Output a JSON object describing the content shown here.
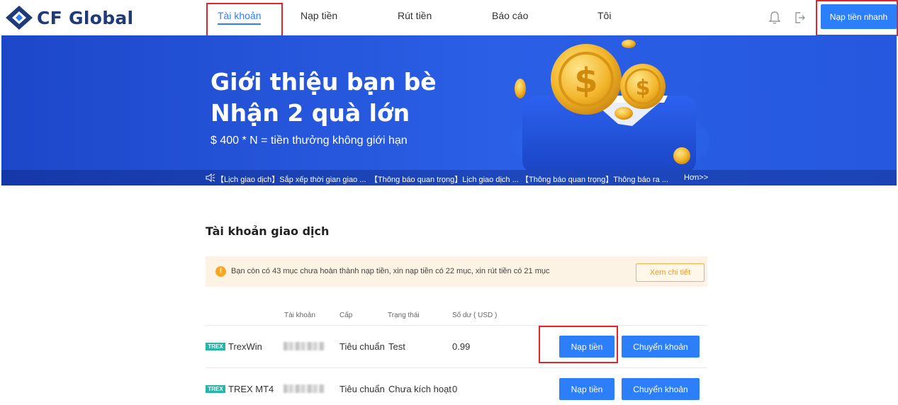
{
  "brand": {
    "name": "CF Global"
  },
  "nav": {
    "items": [
      {
        "label": "Tài khoản",
        "active": true
      },
      {
        "label": "Nạp tiền",
        "active": false
      },
      {
        "label": "Rút tiền",
        "active": false
      },
      {
        "label": "Báo cáo",
        "active": false
      },
      {
        "label": "Tôi",
        "active": false
      }
    ],
    "quick_deposit": "Nạp tiền nhanh",
    "icons": [
      "bell-icon",
      "logout-icon"
    ]
  },
  "banner": {
    "title_line1": "Giới thiệu bạn bè",
    "title_line2": "Nhận 2 quà lớn",
    "subtitle": "$ 400 * N = tiền thưởng không giới hạn",
    "tickers": [
      "【Lịch giao dịch】Sắp xếp thời gian giao ...",
      "【Thông báo quan trọng】Lịch giao dịch ...",
      "【Thông báo quan trọng】Thông báo ra ..."
    ],
    "more": "Hơn>>"
  },
  "accounts": {
    "title": "Tài khoản giao dịch",
    "notice": {
      "text": "Bạn còn có 43 mục chưa hoàn thành nạp tiền, xin nạp tiền có 22 mục, xin rút tiền có 21 mục",
      "button": "Xem chi tiết"
    },
    "headers": [
      "Tài khoản",
      "Cấp",
      "Trạng thái",
      "Số dư ( USD )"
    ],
    "rows": [
      {
        "tag": "TREX",
        "name": "TrexWin",
        "level": "Tiêu chuẩn",
        "status": "Test",
        "balance": "0.99",
        "deposit": "Nạp tiền",
        "transfer": "Chuyển khoản"
      },
      {
        "tag": "TREX",
        "name": "TREX MT4",
        "level": "Tiêu chuẩn",
        "status": "Chưa kích hoạt",
        "balance": "0",
        "deposit": "Nạp tiền",
        "transfer": "Chuyển khoản"
      }
    ]
  },
  "colors": {
    "accent": "#2d7ff9",
    "banner": "#2558de",
    "highlight": "#e0262c",
    "notice_bg": "#fdf3e4",
    "notice_accent": "#f5a623",
    "tag": "#2bb3a7"
  }
}
